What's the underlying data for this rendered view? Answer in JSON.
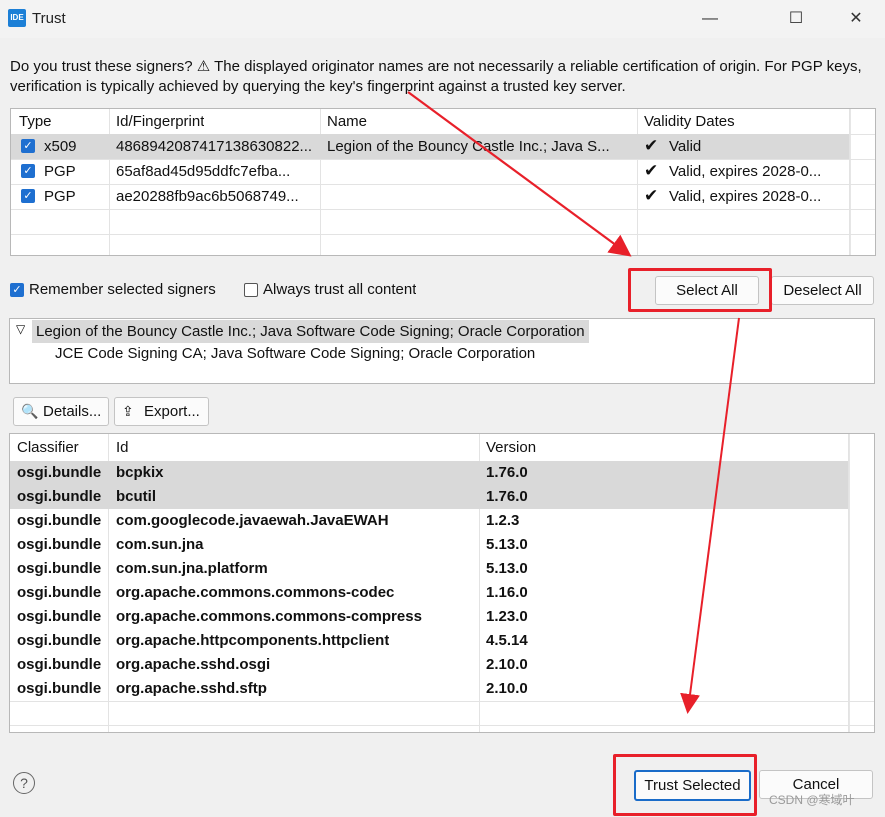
{
  "window": {
    "title": "Trust",
    "app_icon_label": "IDE"
  },
  "message": "Do you trust these signers?  ⚠ The displayed originator names are not necessarily a reliable certification of origin.  For PGP keys, verification is typically achieved by querying the key's fingerprint against a trusted key server.",
  "signers": {
    "columns": [
      "Type",
      "Id/Fingerprint",
      "Name",
      "Validity Dates"
    ],
    "rows": [
      {
        "type": "x509",
        "id": "4868942087417138630822...",
        "name": "Legion of the Bouncy Castle Inc.; Java S...",
        "validity": "Valid",
        "checked": true
      },
      {
        "type": "PGP",
        "id": "65af8ad45d95ddfc7efba...",
        "name": "",
        "validity": "Valid, expires 2028-0...",
        "checked": true
      },
      {
        "type": "PGP",
        "id": "ae20288fb9ac6b5068749...",
        "name": "",
        "validity": "Valid, expires 2028-0...",
        "checked": true
      }
    ]
  },
  "options": {
    "remember_label": "Remember selected signers",
    "remember_checked": true,
    "always_trust_label": "Always trust all content",
    "always_trust_checked": false
  },
  "buttons": {
    "select_all": "Select All",
    "deselect_all": "Deselect All",
    "details": "Details...",
    "export": "Export...",
    "trust_selected": "Trust Selected",
    "cancel": "Cancel"
  },
  "chain": {
    "root": "Legion of the Bouncy Castle Inc.; Java Software Code Signing; Oracle Corporation",
    "child": "JCE Code Signing CA; Java Software Code Signing; Oracle Corporation"
  },
  "artifacts": {
    "columns": [
      "Classifier",
      "Id",
      "Version"
    ],
    "rows": [
      {
        "classifier": "osgi.bundle",
        "id": "bcpkix",
        "version": "1.76.0",
        "selected": true
      },
      {
        "classifier": "osgi.bundle",
        "id": "bcutil",
        "version": "1.76.0",
        "selected": true
      },
      {
        "classifier": "osgi.bundle",
        "id": "com.googlecode.javaewah.JavaEWAH",
        "version": "1.2.3",
        "selected": false
      },
      {
        "classifier": "osgi.bundle",
        "id": "com.sun.jna",
        "version": "5.13.0",
        "selected": false
      },
      {
        "classifier": "osgi.bundle",
        "id": "com.sun.jna.platform",
        "version": "5.13.0",
        "selected": false
      },
      {
        "classifier": "osgi.bundle",
        "id": "org.apache.commons.commons-codec",
        "version": "1.16.0",
        "selected": false
      },
      {
        "classifier": "osgi.bundle",
        "id": "org.apache.commons.commons-compress",
        "version": "1.23.0",
        "selected": false
      },
      {
        "classifier": "osgi.bundle",
        "id": "org.apache.httpcomponents.httpclient",
        "version": "4.5.14",
        "selected": false
      },
      {
        "classifier": "osgi.bundle",
        "id": "org.apache.sshd.osgi",
        "version": "2.10.0",
        "selected": false
      },
      {
        "classifier": "osgi.bundle",
        "id": "org.apache.sshd.sftp",
        "version": "2.10.0",
        "selected": false
      }
    ]
  },
  "watermark": "CSDN @寒域叶",
  "colors": {
    "annotation_red": "#e8202a",
    "checkbox_blue": "#1e6fd0",
    "selection_gray": "#d9d9d9"
  }
}
